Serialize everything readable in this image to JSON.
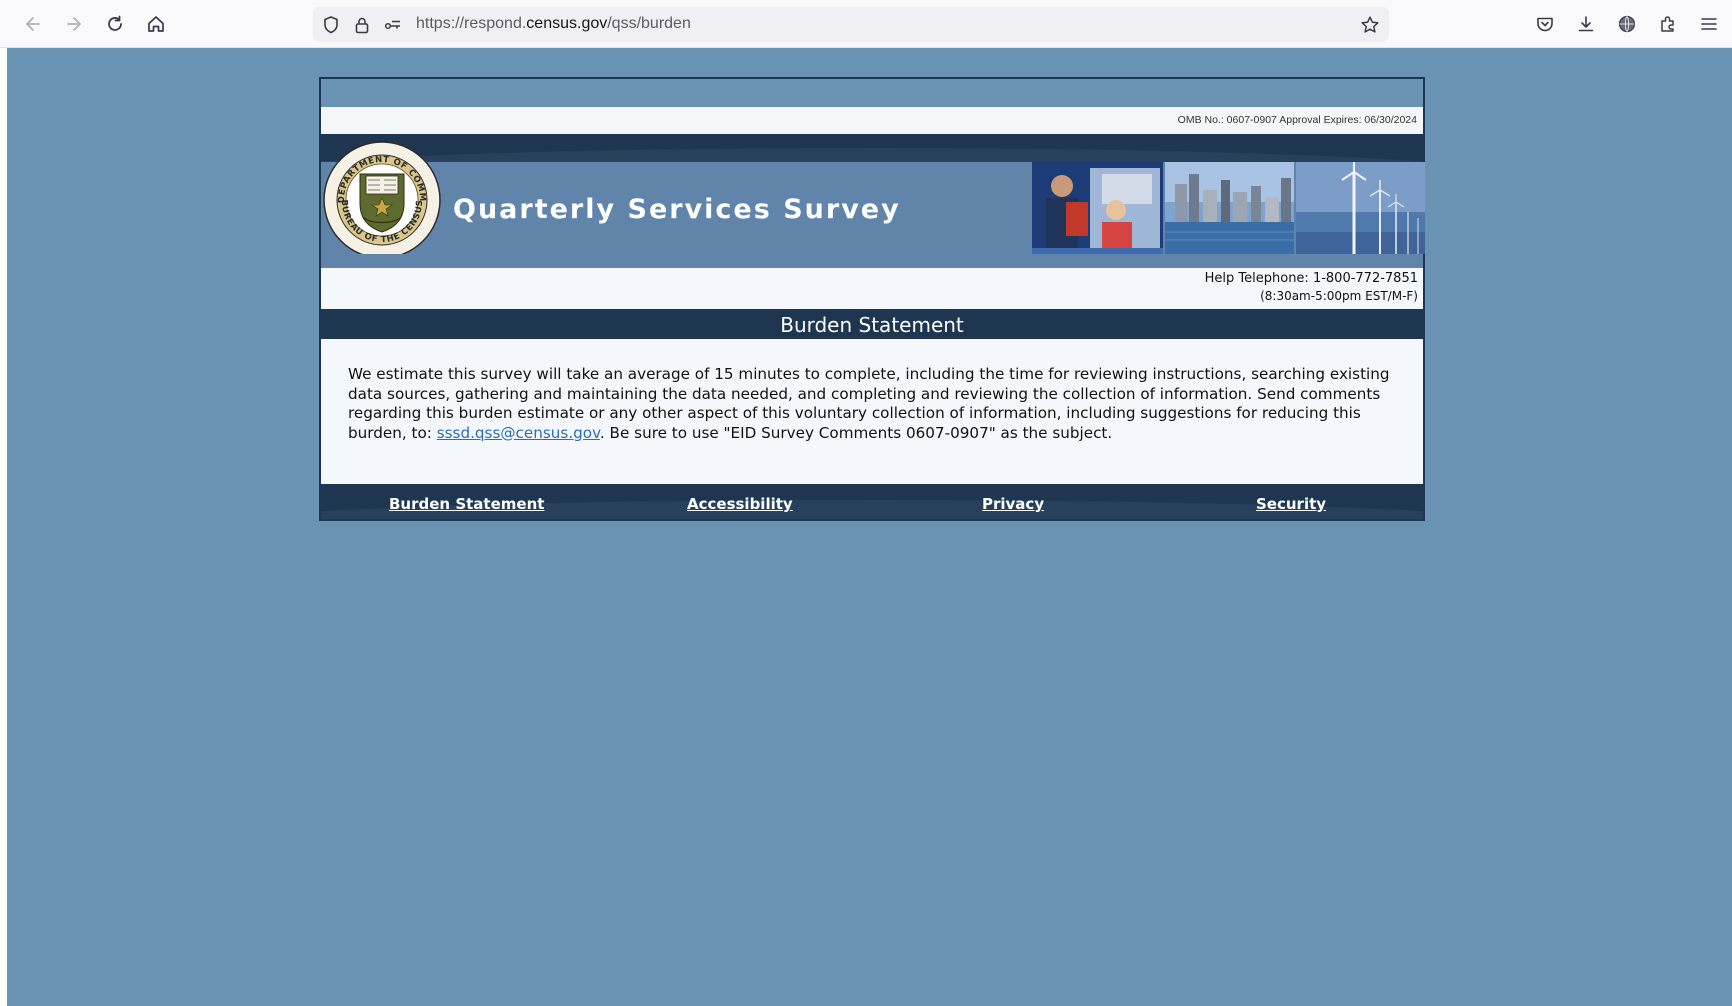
{
  "browser": {
    "url_prefix": "https://respond.",
    "url_domain": "census.gov",
    "url_path": "/qss/burden"
  },
  "header": {
    "omb_text": "OMB No.: 0607-0907 Approval Expires: 06/30/2024",
    "survey_title": "Quarterly Services Survey",
    "seal_text_top": "U.S. DEPARTMENT OF COMMERCE",
    "seal_text_bottom": "BUREAU OF THE CENSUS",
    "help_phone": "Help Telephone: 1-800-772-7851",
    "help_hours": "(8:30am-5:00pm EST/M-F)"
  },
  "section": {
    "title": "Burden Statement"
  },
  "body": {
    "text_before_link": "We estimate this survey will take an average of 15 minutes to complete, including the time for reviewing instructions, searching existing data sources, gathering and maintaining the data needed, and completing and reviewing the collection of information. Send comments regarding this burden estimate or any other aspect of this voluntary collection of information, including suggestions for reducing this burden, to: ",
    "email_link": "sssd.qss@census.gov",
    "text_after_link": ". Be sure to use \"EID Survey Comments 0607-0907\" as the subject."
  },
  "footer": {
    "links": [
      "Burden Statement",
      "Accessibility",
      "Privacy",
      "Security"
    ]
  },
  "colors": {
    "page_background": "#6893b2",
    "dark_navy": "#1f3650",
    "header_blue": "#6184ab",
    "link_blue": "#2a6db0"
  }
}
